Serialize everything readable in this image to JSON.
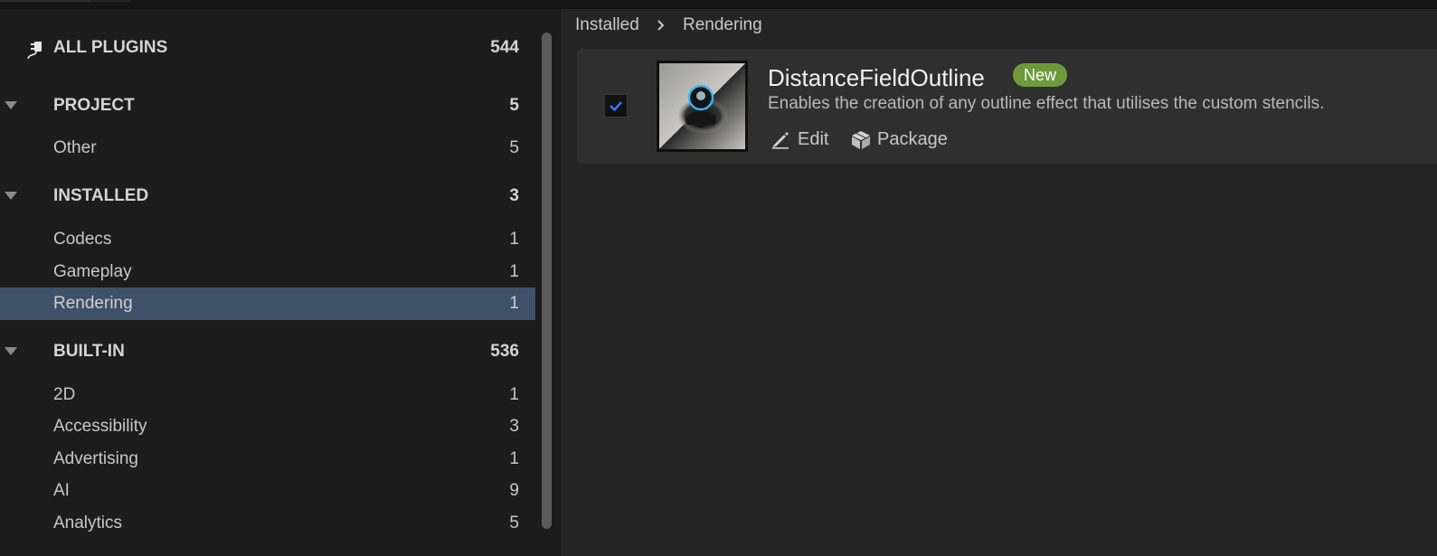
{
  "sidebar": {
    "all_plugins": {
      "label": "ALL PLUGINS",
      "count": "544"
    },
    "project": {
      "label": "PROJECT",
      "count": "5",
      "items": [
        {
          "label": "Other",
          "count": "5"
        }
      ]
    },
    "installed": {
      "label": "INSTALLED",
      "count": "3",
      "items": [
        {
          "label": "Codecs",
          "count": "1"
        },
        {
          "label": "Gameplay",
          "count": "1"
        },
        {
          "label": "Rendering",
          "count": "1",
          "selected": true
        }
      ]
    },
    "builtin": {
      "label": "BUILT-IN",
      "count": "536",
      "items": [
        {
          "label": "2D",
          "count": "1"
        },
        {
          "label": "Accessibility",
          "count": "3"
        },
        {
          "label": "Advertising",
          "count": "1"
        },
        {
          "label": "AI",
          "count": "9"
        },
        {
          "label": "Analytics",
          "count": "5"
        }
      ]
    }
  },
  "breadcrumb": {
    "root": "Installed",
    "current": "Rendering"
  },
  "plugin": {
    "name": "DistanceFieldOutline",
    "badge": "New",
    "description": "Enables the creation of any outline effect that utilises the custom stencils.",
    "enabled": true,
    "edit_label": "Edit",
    "package_label": "Package"
  },
  "colors": {
    "accent_selected": "#3e5168",
    "badge_green": "#6f9a3c",
    "check_blue": "#2f7fff"
  },
  "icons": {
    "all_plugins": "plug-icon",
    "collapse": "caret-down-icon",
    "separator": "chevron-right-icon",
    "edit": "pencil-icon",
    "package": "box-icon"
  }
}
